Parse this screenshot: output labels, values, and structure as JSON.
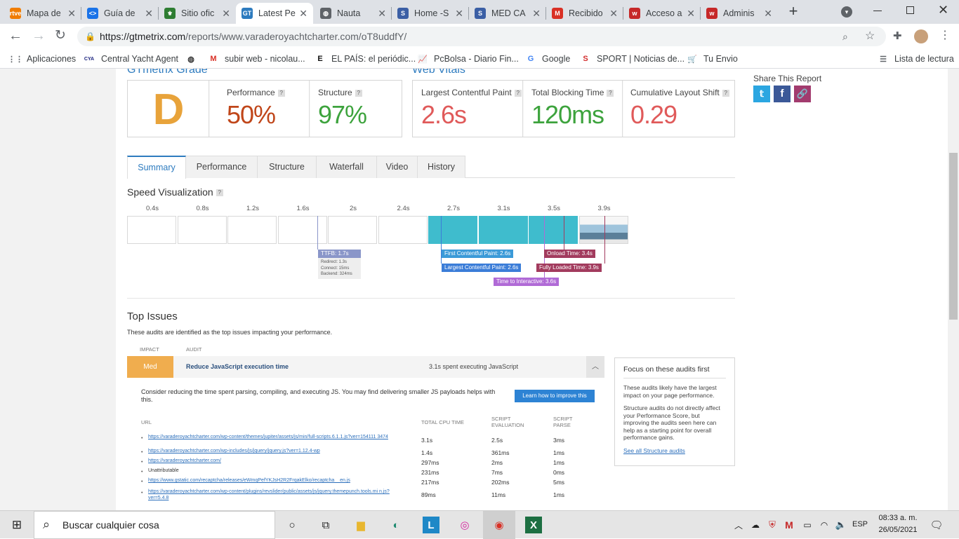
{
  "tabs": [
    {
      "title": "Mapa de",
      "icon": "rtve-icon",
      "fav": "rtve",
      "color": "#f07c00"
    },
    {
      "title": "Guía de",
      "icon": "code-icon",
      "fav": "<>",
      "color": "#1a73e8"
    },
    {
      "title": "Sitio ofic",
      "icon": "shield-icon",
      "fav": "⚜",
      "color": "#2e7d32"
    },
    {
      "title": "Latest Pe",
      "icon": "gtmetrix-icon",
      "fav": "GT",
      "color": "#2d7bbf",
      "active": true
    },
    {
      "title": "Nauta",
      "icon": "globe-icon",
      "fav": "◍",
      "color": "#5f6368"
    },
    {
      "title": "Home -S",
      "icon": "s-logo-icon",
      "fav": "S",
      "color": "#3b5fa5"
    },
    {
      "title": "MED CA",
      "icon": "s-logo-icon",
      "fav": "S",
      "color": "#3b5fa5"
    },
    {
      "title": "Recibido",
      "icon": "gmail-icon",
      "fav": "M",
      "color": "#d93025"
    },
    {
      "title": "Acceso a",
      "icon": "w-logo-icon",
      "fav": "w",
      "color": "#c62828"
    },
    {
      "title": "Adminis",
      "icon": "w-circle-icon",
      "fav": "w",
      "color": "#c62828"
    }
  ],
  "browser": {
    "url_host": "https://gtmetrix.com",
    "url_path": "/reports/www.varaderoyachtcharter.com/oT8uddfY/",
    "new_tab": "+"
  },
  "bookmarks": [
    {
      "label": "Aplicaciones",
      "icon": "apps-grid-icon",
      "glyph": "⋮⋮"
    },
    {
      "label": "Central Yacht Agent",
      "icon": "cya-icon",
      "glyph": "CYA"
    },
    {
      "label": "",
      "icon": "globe-icon",
      "glyph": "◍"
    },
    {
      "label": "subir web - nicolau...",
      "icon": "gmail-icon",
      "glyph": "M"
    },
    {
      "label": "EL PAÍS: el periódic...",
      "icon": "elpais-icon",
      "glyph": "E"
    },
    {
      "label": "PcBolsa - Diario Fin...",
      "icon": "chart-icon",
      "glyph": "📈"
    },
    {
      "label": "Google",
      "icon": "google-icon",
      "glyph": "G"
    },
    {
      "label": "SPORT | Noticias de...",
      "icon": "sport-icon",
      "glyph": "S"
    },
    {
      "label": "Tu Envio",
      "icon": "cart-icon",
      "glyph": "🛒"
    }
  ],
  "reading_list": "Lista de lectura",
  "grade": {
    "heading": "GTmetrix Grade",
    "letter": "D",
    "performance_label": "Performance",
    "performance_value": "50%",
    "structure_label": "Structure",
    "structure_value": "97%"
  },
  "vitals": {
    "heading": "Web Vitals",
    "lcp_label": "Largest Contentful Paint",
    "lcp_value": "2.6s",
    "tbt_label": "Total Blocking Time",
    "tbt_value": "120ms",
    "cls_label": "Cumulative Layout Shift",
    "cls_value": "0.29"
  },
  "share": {
    "title": "Share This Report"
  },
  "subtabs": [
    "Summary",
    "Performance",
    "Structure",
    "Waterfall",
    "Video",
    "History"
  ],
  "speed": {
    "title": "Speed Visualization",
    "ticks": [
      "0.4s",
      "0.8s",
      "1.2s",
      "1.6s",
      "2s",
      "2.4s",
      "2.7s",
      "3.1s",
      "3.5s",
      "3.9s"
    ],
    "ttfb": "TTFB: 1.7s",
    "redirect": "Redirect: 1.3s",
    "connect": "Connect: 15ms",
    "backend": "Backend: 324ms",
    "fcp": "First Contentful Paint: 2.6s",
    "lcp": "Largest Contentful Paint: 2.6s",
    "tti": "Time to Interactive: 3.6s",
    "onload": "Onload Time: 3.4s",
    "fully": "Fully Loaded Time: 3.9s"
  },
  "issues": {
    "title": "Top Issues",
    "subtitle": "These audits are identified as the top issues impacting your performance.",
    "col_impact": "IMPACT",
    "col_audit": "AUDIT",
    "impact": "Med",
    "audit_title": "Reduce JavaScript execution time",
    "audit_summary": "3.1s spent executing JavaScript",
    "description": "Consider reducing the time spent parsing, compiling, and executing JS. You may find delivering smaller JS payloads helps with this.",
    "learn_button": "Learn how to improve this",
    "th_url": "URL",
    "th_cpu": "TOTAL CPU TIME",
    "th_eval": "SCRIPT EVALUATION",
    "th_parse": "SCRIPT PARSE",
    "rows": [
      {
        "url": "https://varaderoyachtcharter.com/wp-content/themes/jupiter/assets/js/min/full-scripts.6.1.1.js?ver=154111 3474",
        "cpu": "3.1s",
        "eval": "2.5s",
        "parse": "3ms",
        "link": true
      },
      {
        "url": "https://varaderoyachtcharter.com/wp-includes/js/jquery/jquery.js?ver=1.12.4-wp",
        "cpu": "1.4s",
        "eval": "361ms",
        "parse": "1ms",
        "link": true
      },
      {
        "url": "https://varaderoyachtcharter.com/",
        "cpu": "297ms",
        "eval": "2ms",
        "parse": "1ms",
        "link": true
      },
      {
        "url": "Unattributable",
        "cpu": "231ms",
        "eval": "7ms",
        "parse": "0ms",
        "link": false
      },
      {
        "url": "https://www.gstatic.com/recaptcha/releases/eWmqPefYKJsH2R2FrqakElko/recaptcha__en.js",
        "cpu": "217ms",
        "eval": "202ms",
        "parse": "5ms",
        "link": true
      },
      {
        "url": "https://varaderoyachtcharter.com/wp-content/plugins/revslider/public/assets/js/jquery.themepunch.tools.mi n.js?ver=5.4.8",
        "cpu": "89ms",
        "eval": "11ms",
        "parse": "1ms",
        "link": true
      }
    ]
  },
  "focus": {
    "title": "Focus on these audits first",
    "p1": "These audits likely have the largest impact on your page performance.",
    "p2": "Structure audits do not directly affect your Performance Score, but improving the audits seen here can help as a starting point for overall performance gains.",
    "link": "See all Structure audits"
  },
  "taskbar": {
    "search_placeholder": "Buscar cualquier cosa",
    "lang": "ESP",
    "time": "08:33 a. m.",
    "date": "26/05/2021"
  },
  "colors": {
    "grade_d": "#e8a33a",
    "perf": "#c0461a",
    "struct": "#3da33d",
    "bad": "#e05a5a",
    "good": "#3da33d",
    "accent": "#2d7bbf",
    "marker_blue": "#3b7dd8",
    "marker_purple": "#b06ad6",
    "marker_red": "#a23b5e",
    "ttfb": "#8a96c9"
  }
}
